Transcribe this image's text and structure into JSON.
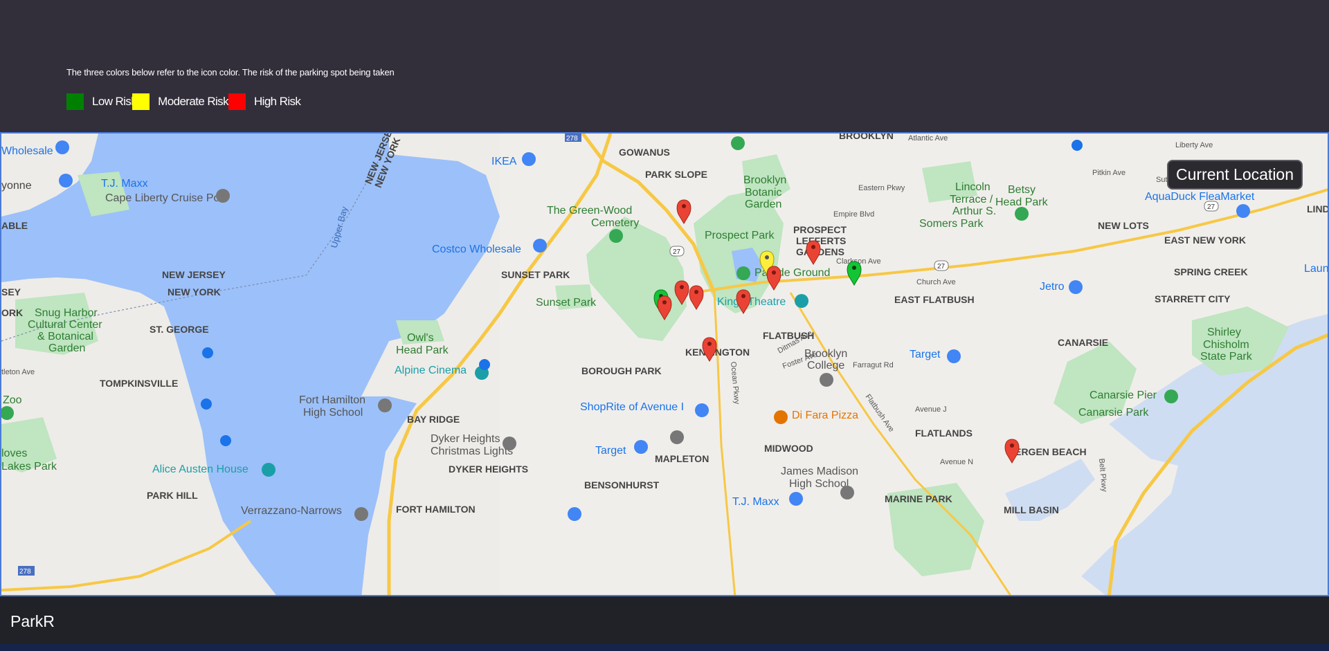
{
  "header": {
    "legend_note": "The three colors below refer to the icon color. The risk of the parking spot being taken",
    "legend": [
      {
        "label": "Low Risk",
        "color": "#008000"
      },
      {
        "label": "Moderate Risk",
        "color": "#ffff00"
      },
      {
        "label": "High Risk",
        "color": "#ff0000"
      }
    ]
  },
  "map": {
    "current_location_label": "Current Location",
    "water_color": "#9cc0f9",
    "park_color": "#bfe5c1",
    "labels": {
      "brooklyn": "BROOKLYN",
      "gowanus": "GOWANUS",
      "park_slope": "PARK SLOPE",
      "green_wood": "The Green-Wood",
      "cemetery": "Cemetery",
      "prospect_park": "Prospect Park",
      "brooklyn_botanic_1": "Brooklyn",
      "brooklyn_botanic_2": "Botanic",
      "brooklyn_botanic_3": "Garden",
      "prospect_lefferts_1": "PROSPECT",
      "prospect_lefferts_2": "LEFFERTS",
      "prospect_lefferts_3": "GARDENS",
      "lincoln_terrace_1": "Lincoln",
      "lincoln_terrace_2": "Terrace /",
      "lincoln_terrace_3": "Arthur S.",
      "lincoln_terrace_4": "Somers Park",
      "betsy_head_1": "Betsy",
      "betsy_head_2": "Head Park",
      "new_lots": "NEW LOTS",
      "east_new_york": "EAST NEW YORK",
      "spring_creek": "SPRING CREEK",
      "starrett_city": "STARRETT CITY",
      "aquaduck": "AquaDuck FleaMarket",
      "ikea": "IKEA",
      "costco": "Costco Wholesale",
      "sunset_park_hood": "SUNSET PARK",
      "sunset_park": "Sunset Park",
      "parade_ground": "Parade Ground",
      "kings_theatre": "Kings Theatre",
      "east_flatbush": "EAST FLATBUSH",
      "flatbush": "FLATBUSH",
      "kensington": "KENSINGTON",
      "brooklyn_college_1": "Brooklyn",
      "brooklyn_college_2": "College",
      "target_1": "Target",
      "canarsie": "CANARSIE",
      "shirley_1": "Shirley",
      "shirley_2": "Chisholm",
      "shirley_3": "State Park",
      "canarsie_pier": "Canarsie Pier",
      "canarsie_park": "Canarsie Park",
      "jetro": "Jetro",
      "borough_park": "BOROUGH PARK",
      "owls_head_1": "Owl's",
      "owls_head_2": "Head Park",
      "alpine_cinema": "Alpine Cinema",
      "fort_hamilton_hs_1": "Fort Hamilton",
      "fort_hamilton_hs_2": "High School",
      "bay_ridge": "BAY RIDGE",
      "shoprite": "ShopRite of Avenue I",
      "di_fara": "Di Fara Pizza",
      "dyker_lights_1": "Dyker Heights",
      "dyker_lights_2": "Christmas Lights",
      "target_2": "Target",
      "dyker_heights": "DYKER HEIGHTS",
      "mapleton": "MAPLETON",
      "midwood": "MIDWOOD",
      "flatlands": "FLATLANDS",
      "james_madison_1": "James Madison",
      "james_madison_2": "High School",
      "bensonhurst": "BENSONHURST",
      "tj_maxx_1": "T.J. Maxx",
      "marine_park": "MARINE PARK",
      "mill_basin": "MILL BASIN",
      "bergen_beach": "BERGEN BEACH",
      "fort_hamilton": "FORT HAMILTON",
      "new_jersey": "NEW JERSEY",
      "new_york": "NEW YORK",
      "upper_bay": "Upper Bay",
      "nj_ny_1": "NEW JERSEY",
      "nj_ny_2": "NEW YORK",
      "wholesale": "Wholesale",
      "tj_maxx_2": "T.J. Maxx",
      "cape_liberty": "Cape Liberty Cruise Port",
      "bayonne": "yonne",
      "able": "ABLE",
      "snug_harbor_1": "Snug Harbor",
      "snug_harbor_2": "Cultural Center",
      "snug_harbor_3": "& Botanical",
      "snug_harbor_4": "Garden",
      "st_george": "ST. GEORGE",
      "tompkinsville": "TOMPKINSVILLE",
      "zoo": "Zoo",
      "clove_lakes_1": "loves",
      "clove_lakes_2": "Lakes Park",
      "alice_austen": "Alice Austen House",
      "park_hill": "PARK HILL",
      "verrazzano": "Verrazzano-Narrows",
      "church_ave": "Church Ave",
      "clarkson_ave": "Clarkson Ave",
      "empire_blvd": "Empire Blvd",
      "eastern_pkwy": "Eastern Pkwy",
      "atlantic_ave": "Atlantic Ave",
      "pitkin_ave": "Pitkin Ave",
      "sutter_ave": "Sutter Ave",
      "liberty_ave": "Liberty Ave",
      "belt_pkwy": "Belt Pkwy",
      "ocean_pkwy": "Ocean Pkwy",
      "foster_ave": "Foster Ave",
      "avenue_j": "Avenue J",
      "avenue_n": "Avenue N",
      "flatbush_ave": "Flatbush Ave",
      "farragut_rd": "Farragut Rd",
      "ditmas_ave": "Ditmas Ave",
      "route_27": "27",
      "route_278": "278",
      "launch": "Launch",
      "lind": "LIND",
      "sey": "SEY",
      "ork": "ORK",
      "ave_label": "tleton Ave"
    }
  },
  "footer": {
    "brand": "ParkR"
  }
}
